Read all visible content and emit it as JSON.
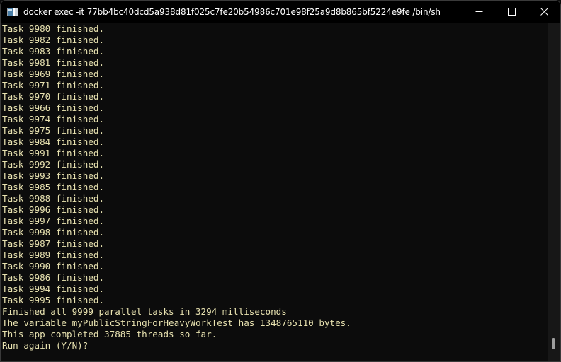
{
  "window": {
    "title": "docker  exec -it 77bb4bc40dcd5a938d81f025c7fe20b54986c701e98f25a9d8b865bf5224e9fe /bin/sh",
    "icon": "terminal-app-icon",
    "controls": {
      "minimize": "minimize-icon",
      "maximize": "maximize-icon",
      "close": "close-icon"
    }
  },
  "terminal": {
    "text_color": "#e8e2b0",
    "background": "#0c0c0c",
    "lines": [
      "Task 9980 finished.",
      "Task 9982 finished.",
      "Task 9983 finished.",
      "Task 9981 finished.",
      "Task 9969 finished.",
      "Task 9971 finished.",
      "Task 9970 finished.",
      "Task 9966 finished.",
      "Task 9974 finished.",
      "Task 9975 finished.",
      "Task 9984 finished.",
      "Task 9991 finished.",
      "Task 9992 finished.",
      "Task 9993 finished.",
      "Task 9985 finished.",
      "Task 9988 finished.",
      "Task 9996 finished.",
      "Task 9997 finished.",
      "Task 9998 finished.",
      "Task 9987 finished.",
      "Task 9989 finished.",
      "Task 9990 finished.",
      "Task 9986 finished.",
      "Task 9994 finished.",
      "Task 9995 finished.",
      "Finished all 9999 parallel tasks in 3294 milliseconds",
      "The variable myPublicStringForHeavyWorkTest has 1348765110 bytes.",
      "This app completed 37885 threads so far.",
      "Run again (Y/N)?"
    ]
  },
  "scrollbar": {
    "position_fraction": 1.0
  }
}
